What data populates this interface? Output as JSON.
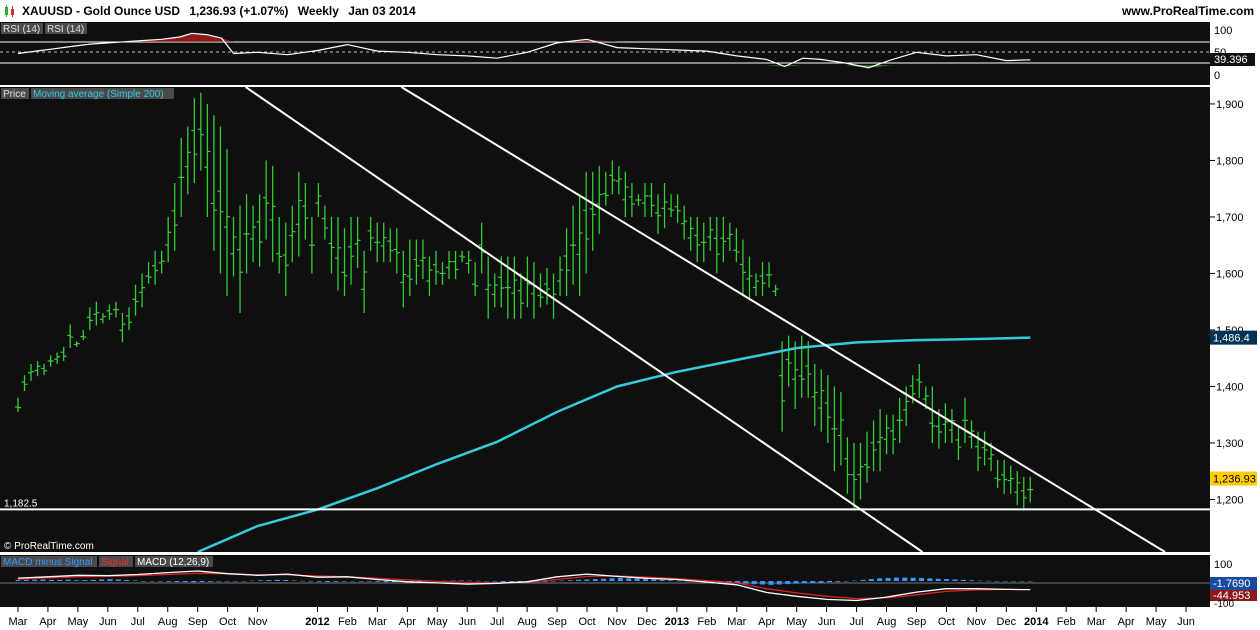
{
  "header": {
    "symbol": "XAUUSD - Gold Ounce USD",
    "price_change": "1,236.93 (+1.07%)",
    "timeframe": "Weekly",
    "date": "Jan 03 2014",
    "site": "www.ProRealTime.com"
  },
  "rsi_panel": {
    "labels": [
      "RSI (14)",
      "RSI (14)"
    ],
    "axis_ticks": [
      "100",
      "50",
      "0"
    ],
    "current_value": "39.396"
  },
  "price_panel": {
    "labels": [
      "Price",
      "Moving average (Simple 200)"
    ],
    "support_label": "1,182.5",
    "copyright": "© ProRealTime.com",
    "ma_value": "1,486.4",
    "last_price": "1,236.93"
  },
  "macd_panel": {
    "labels": [
      "MACD minus Signal",
      "Signal",
      "MACD (12,26,9)"
    ],
    "axis_ticks": [
      "100",
      "0",
      "-100"
    ],
    "macd_value": "-1.7690",
    "signal_value": "-44.953"
  },
  "colors": {
    "background": "#0f0f0f",
    "bar": "#33cc33",
    "ma": "#33ccdd",
    "line": "#ffffff",
    "rsi_overbought": "#8b1a1a",
    "rsi_oversold": "#2a8a2a",
    "histogram": "#3399ff",
    "signal": "#dd2222",
    "ma_tag": "#003355",
    "price_tag": "#ffcc00"
  },
  "chart_data": {
    "type": "bar",
    "title": "XAUUSD - Gold Ounce USD",
    "timeframe": "Weekly",
    "x_labels": [
      {
        "label": "Mar",
        "x": 0
      },
      {
        "label": "Apr",
        "x": 1
      },
      {
        "label": "May",
        "x": 2
      },
      {
        "label": "Jun",
        "x": 3
      },
      {
        "label": "Jul",
        "x": 4
      },
      {
        "label": "Aug",
        "x": 5
      },
      {
        "label": "Sep",
        "x": 6
      },
      {
        "label": "Oct",
        "x": 7
      },
      {
        "label": "Nov",
        "x": 8
      },
      {
        "label": "2012",
        "x": 10,
        "bold": true
      },
      {
        "label": "Feb",
        "x": 11
      },
      {
        "label": "Mar",
        "x": 12
      },
      {
        "label": "Apr",
        "x": 13
      },
      {
        "label": "May",
        "x": 14
      },
      {
        "label": "Jun",
        "x": 15
      },
      {
        "label": "Jul",
        "x": 16
      },
      {
        "label": "Aug",
        "x": 17
      },
      {
        "label": "Sep",
        "x": 18
      },
      {
        "label": "Oct",
        "x": 19
      },
      {
        "label": "Nov",
        "x": 20
      },
      {
        "label": "Dec",
        "x": 21
      },
      {
        "label": "2013",
        "x": 22,
        "bold": true
      },
      {
        "label": "Feb",
        "x": 23
      },
      {
        "label": "Mar",
        "x": 24
      },
      {
        "label": "Apr",
        "x": 25
      },
      {
        "label": "May",
        "x": 26
      },
      {
        "label": "Jun",
        "x": 27
      },
      {
        "label": "Jul",
        "x": 28
      },
      {
        "label": "Aug",
        "x": 29
      },
      {
        "label": "Sep",
        "x": 30
      },
      {
        "label": "Oct",
        "x": 31
      },
      {
        "label": "Nov",
        "x": 32
      },
      {
        "label": "Dec",
        "x": 33
      },
      {
        "label": "2014",
        "x": 34,
        "bold": true
      },
      {
        "label": "Feb",
        "x": 35
      },
      {
        "label": "Mar",
        "x": 36
      },
      {
        "label": "Apr",
        "x": 37
      },
      {
        "label": "May",
        "x": 38
      },
      {
        "label": "Jun",
        "x": 39
      }
    ],
    "y_ticks": [
      1200,
      1300,
      1400,
      1500,
      1600,
      1700,
      1800,
      1900
    ],
    "ylim": [
      1107,
      1930
    ],
    "xlim": [
      -0.6,
      39.8
    ],
    "price_bars": {
      "low": [
        1355,
        1392,
        1410,
        1418,
        1420,
        1435,
        1440,
        1445,
        1468,
        1470,
        1482,
        1500,
        1508,
        1512,
        1518,
        1522,
        1478,
        1500,
        1525,
        1540,
        1582,
        1580,
        1600,
        1620,
        1640,
        1700,
        1740,
        1760,
        1782,
        1700,
        1640,
        1600,
        1560,
        1595,
        1530,
        1600,
        1620,
        1612,
        1660,
        1620,
        1600,
        1560,
        1620,
        1630,
        1660,
        1600,
        1700,
        1660,
        1600,
        1570,
        1560,
        1580,
        1610,
        1530,
        1640,
        1620,
        1620,
        1620,
        1600,
        1540,
        1560,
        1580,
        1590,
        1560,
        1580,
        1580,
        1590,
        1590,
        1620,
        1600,
        1560,
        1600,
        1520,
        1540,
        1540,
        1520,
        1520,
        1520,
        1540,
        1520,
        1540,
        1545,
        1520,
        1560,
        1560,
        1580,
        1560,
        1600,
        1640,
        1670,
        1720,
        1740,
        1740,
        1700,
        1700,
        1720,
        1700,
        1700,
        1670,
        1680,
        1700,
        1690,
        1660,
        1640,
        1620,
        1620,
        1640,
        1600,
        1620,
        1640,
        1620,
        1560,
        1555,
        1560,
        1560,
        1575,
        1560,
        1320,
        1400,
        1360,
        1380,
        1380,
        1330,
        1320,
        1300,
        1250,
        1260,
        1210,
        1180,
        1200,
        1230,
        1250,
        1250,
        1280,
        1280,
        1300,
        1330,
        1370,
        1380,
        1360,
        1300,
        1290,
        1300,
        1300,
        1270,
        1300,
        1290,
        1250,
        1260,
        1250,
        1220,
        1210,
        1210,
        1190,
        1180,
        1195
      ],
      "high": [
        1380,
        1420,
        1440,
        1445,
        1440,
        1455,
        1460,
        1470,
        1510,
        1480,
        1500,
        1540,
        1550,
        1530,
        1545,
        1550,
        1530,
        1540,
        1580,
        1600,
        1620,
        1640,
        1640,
        1700,
        1760,
        1840,
        1860,
        1910,
        1920,
        1900,
        1880,
        1860,
        1820,
        1700,
        1720,
        1740,
        1720,
        1740,
        1800,
        1790,
        1700,
        1690,
        1720,
        1780,
        1760,
        1700,
        1760,
        1720,
        1700,
        1700,
        1680,
        1700,
        1700,
        1640,
        1700,
        1690,
        1690,
        1680,
        1680,
        1640,
        1660,
        1660,
        1660,
        1630,
        1640,
        1620,
        1640,
        1640,
        1640,
        1640,
        1620,
        1690,
        1630,
        1600,
        1630,
        1630,
        1630,
        1600,
        1630,
        1620,
        1600,
        1610,
        1600,
        1630,
        1680,
        1720,
        1740,
        1780,
        1780,
        1790,
        1780,
        1800,
        1790,
        1780,
        1760,
        1740,
        1760,
        1760,
        1740,
        1760,
        1740,
        1740,
        1720,
        1700,
        1700,
        1690,
        1700,
        1700,
        1700,
        1690,
        1680,
        1660,
        1630,
        1600,
        1620,
        1620,
        1580,
        1480,
        1490,
        1480,
        1490,
        1480,
        1440,
        1430,
        1420,
        1400,
        1390,
        1310,
        1300,
        1300,
        1320,
        1340,
        1360,
        1350,
        1350,
        1380,
        1400,
        1420,
        1440,
        1400,
        1400,
        1360,
        1370,
        1360,
        1330,
        1380,
        1340,
        1320,
        1320,
        1300,
        1270,
        1270,
        1260,
        1250,
        1240,
        1240
      ]
    },
    "moving_average": {
      "name": "Moving average (Simple 200)",
      "points": [
        [
          6.0,
          1107
        ],
        [
          8.0,
          1153
        ],
        [
          10.0,
          1182
        ],
        [
          12.0,
          1220
        ],
        [
          14.0,
          1263
        ],
        [
          16.0,
          1302
        ],
        [
          18.0,
          1355
        ],
        [
          20.0,
          1400
        ],
        [
          22.0,
          1426
        ],
        [
          24.0,
          1447
        ],
        [
          26.0,
          1468
        ],
        [
          28.0,
          1478
        ],
        [
          30.0,
          1482
        ],
        [
          32.0,
          1484
        ],
        [
          33.8,
          1486.4
        ]
      ]
    },
    "trend_lines": [
      {
        "from": [
          7.6,
          1930
        ],
        "to": [
          30.2,
          1107
        ]
      },
      {
        "from": [
          12.8,
          1930
        ],
        "to": [
          38.3,
          1107
        ]
      }
    ],
    "support_level": 1182.5,
    "rsi": {
      "ylim": [
        0,
        100
      ],
      "levels": [
        30,
        50,
        70
      ],
      "points": [
        [
          0,
          50
        ],
        [
          0.6,
          54
        ],
        [
          1.2,
          58
        ],
        [
          1.8,
          62
        ],
        [
          2.4,
          66
        ],
        [
          3.0,
          68
        ],
        [
          3.6,
          70
        ],
        [
          4.2,
          72
        ],
        [
          4.8,
          74
        ],
        [
          5.4,
          78
        ],
        [
          5.8,
          84
        ],
        [
          6.3,
          82
        ],
        [
          6.8,
          76
        ],
        [
          7.2,
          50
        ],
        [
          8.0,
          52
        ],
        [
          9.0,
          48
        ],
        [
          10.0,
          55
        ],
        [
          11.0,
          65
        ],
        [
          12.0,
          54
        ],
        [
          13.0,
          52
        ],
        [
          14.0,
          48
        ],
        [
          15.0,
          46
        ],
        [
          16.0,
          42
        ],
        [
          17.0,
          52
        ],
        [
          18.0,
          68
        ],
        [
          19.0,
          74
        ],
        [
          20.0,
          60
        ],
        [
          21.0,
          58
        ],
        [
          22.0,
          56
        ],
        [
          23.0,
          54
        ],
        [
          24.0,
          46
        ],
        [
          25.0,
          40
        ],
        [
          25.6,
          28
        ],
        [
          26.2,
          42
        ],
        [
          26.8,
          40
        ],
        [
          27.6,
          34
        ],
        [
          28.4,
          26
        ],
        [
          29.2,
          40
        ],
        [
          30.0,
          52
        ],
        [
          31.0,
          46
        ],
        [
          32.0,
          48
        ],
        [
          33.0,
          38
        ],
        [
          33.8,
          39.396
        ]
      ]
    },
    "macd": {
      "ylim": [
        -120,
        120
      ],
      "macd_line": [
        [
          0,
          15
        ],
        [
          1,
          22
        ],
        [
          2,
          30
        ],
        [
          3,
          28
        ],
        [
          4,
          34
        ],
        [
          5,
          44
        ],
        [
          6,
          52
        ],
        [
          7,
          38
        ],
        [
          8,
          30
        ],
        [
          9,
          36
        ],
        [
          10,
          20
        ],
        [
          11,
          22
        ],
        [
          12,
          8
        ],
        [
          13,
          -4
        ],
        [
          14,
          -10
        ],
        [
          15,
          -16
        ],
        [
          16,
          -12
        ],
        [
          17,
          -4
        ],
        [
          18,
          22
        ],
        [
          19,
          36
        ],
        [
          20,
          24
        ],
        [
          21,
          14
        ],
        [
          22,
          8
        ],
        [
          23,
          -6
        ],
        [
          24,
          -20
        ],
        [
          25,
          -60
        ],
        [
          26,
          -80
        ],
        [
          27,
          -96
        ],
        [
          28,
          -102
        ],
        [
          29,
          -84
        ],
        [
          30,
          -58
        ],
        [
          31,
          -40
        ],
        [
          32,
          -40
        ],
        [
          33,
          -44
        ],
        [
          33.8,
          -44.953
        ]
      ],
      "signal_line": [
        [
          0,
          10
        ],
        [
          1,
          16
        ],
        [
          2,
          22
        ],
        [
          3,
          24
        ],
        [
          4,
          28
        ],
        [
          5,
          34
        ],
        [
          6,
          40
        ],
        [
          7,
          38
        ],
        [
          8,
          32
        ],
        [
          9,
          32
        ],
        [
          10,
          26
        ],
        [
          11,
          22
        ],
        [
          12,
          14
        ],
        [
          13,
          6
        ],
        [
          14,
          -2
        ],
        [
          15,
          -8
        ],
        [
          16,
          -10
        ],
        [
          17,
          -6
        ],
        [
          18,
          8
        ],
        [
          19,
          24
        ],
        [
          20,
          26
        ],
        [
          21,
          20
        ],
        [
          22,
          12
        ],
        [
          23,
          2
        ],
        [
          24,
          -10
        ],
        [
          25,
          -40
        ],
        [
          26,
          -62
        ],
        [
          27,
          -80
        ],
        [
          28,
          -92
        ],
        [
          29,
          -88
        ],
        [
          30,
          -72
        ],
        [
          31,
          -54
        ],
        [
          32,
          -46
        ],
        [
          33,
          -44
        ],
        [
          33.8,
          -45
        ]
      ],
      "histogram": [
        5,
        6,
        7,
        8,
        6,
        6,
        7,
        4,
        5,
        6,
        8,
        10,
        8,
        5,
        3,
        0,
        -2,
        -3,
        -4,
        -5,
        -5,
        -6,
        -5,
        -4,
        -3,
        -2,
        -1,
        0,
        2,
        4,
        5,
        6,
        5,
        3,
        1,
        -2,
        -4,
        -5,
        -4,
        -3,
        -2,
        -1,
        -3,
        -4,
        -6,
        -6,
        -5,
        -4,
        -3,
        -2,
        -1,
        1,
        2,
        3,
        2,
        1,
        -1,
        -3,
        -6,
        -8,
        -10,
        -8,
        -6,
        -4,
        -2,
        2,
        4,
        6,
        8,
        10,
        12,
        14,
        16,
        14,
        12,
        10,
        8,
        6,
        4,
        2,
        0,
        -2,
        -4,
        -6,
        -8,
        -10,
        -12,
        -14,
        -16,
        -18,
        -20,
        -18,
        -16,
        -14,
        -12,
        -10,
        -8,
        -6,
        -4,
        -2,
        2,
        6,
        10,
        14,
        16,
        18,
        18,
        17,
        16,
        14,
        12,
        10,
        8,
        6,
        4,
        2,
        1,
        0,
        0,
        -1,
        -2,
        -1
      ]
    }
  }
}
